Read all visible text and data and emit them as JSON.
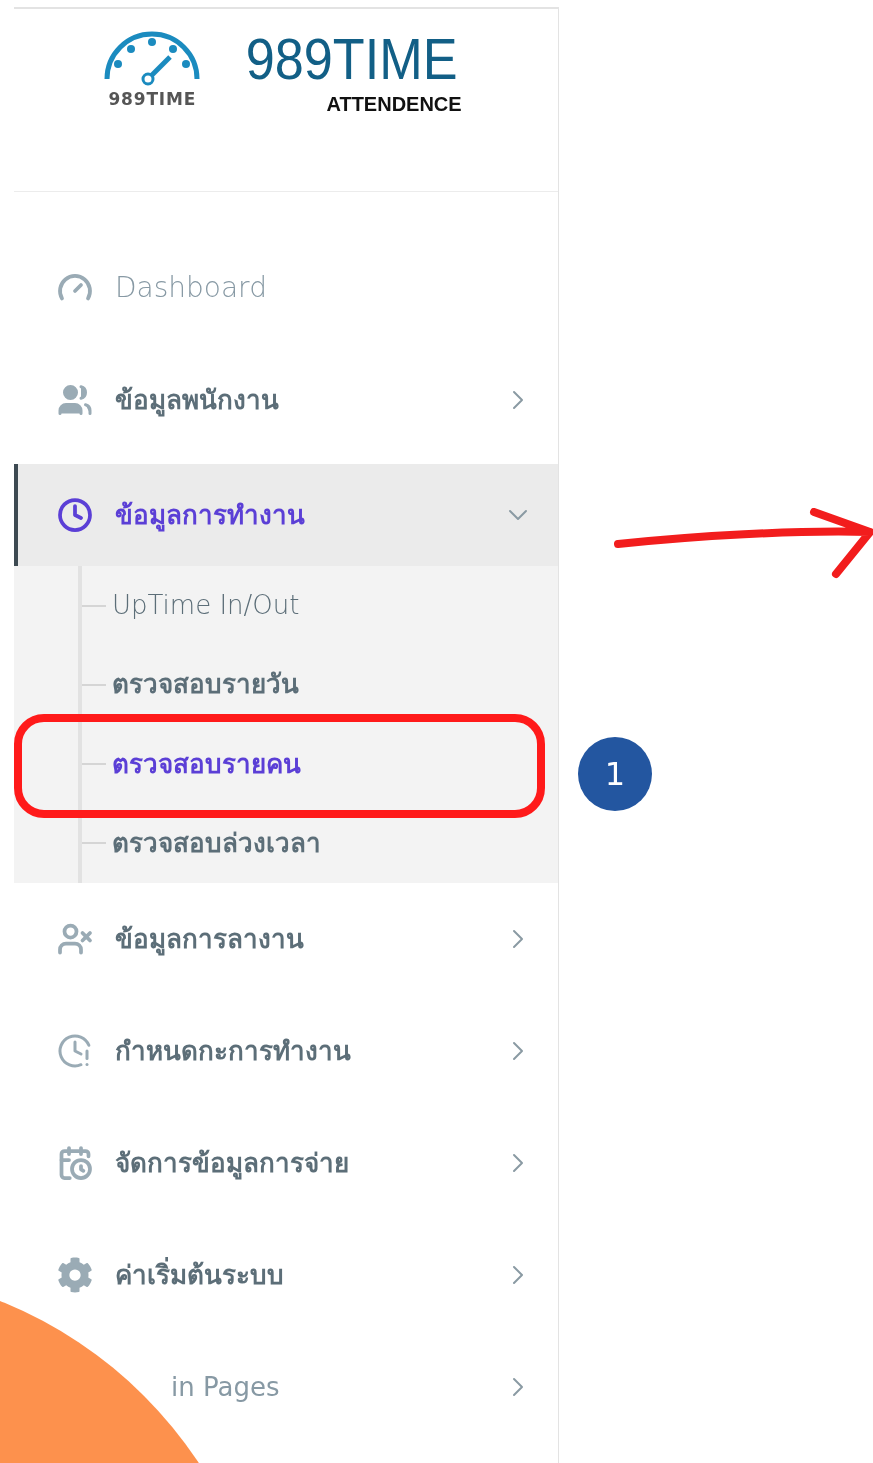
{
  "logo": {
    "emblem_text": "989TIME",
    "title": "989TIME",
    "subtitle": "ATTENDENCE"
  },
  "menu": [
    {
      "label": "Dashboard",
      "kind": "link"
    },
    {
      "label": "ข้อมูลพนักงาน",
      "kind": "group",
      "expanded": false,
      "selected": false
    },
    {
      "label": "ข้อมูลการทำงาน",
      "kind": "group",
      "expanded": true,
      "selected": true,
      "children": [
        {
          "label": "UpTime In/Out",
          "selected": false,
          "kind": "plain"
        },
        {
          "label": "ตรวจสอบรายวัน",
          "selected": false,
          "kind": "strong"
        },
        {
          "label": "ตรวจสอบรายคน",
          "selected": true,
          "kind": "strong"
        },
        {
          "label": "ตรวจสอบล่วงเวลา",
          "selected": false,
          "kind": "strong"
        }
      ]
    },
    {
      "label": "ข้อมูลการลางาน",
      "kind": "group",
      "expanded": false,
      "selected": false
    },
    {
      "label": "กำหนดกะการทำงาน",
      "kind": "group",
      "expanded": false,
      "selected": false
    },
    {
      "label": "จัดการข้อมูลการจ่าย",
      "kind": "group",
      "expanded": false,
      "selected": false
    },
    {
      "label": "ค่าเริ่มต้นระบบ",
      "kind": "group",
      "expanded": false,
      "selected": false
    },
    {
      "label": "in Pages",
      "kind": "group",
      "expanded": false,
      "selected": false
    }
  ],
  "annotation": {
    "badge": "1"
  }
}
